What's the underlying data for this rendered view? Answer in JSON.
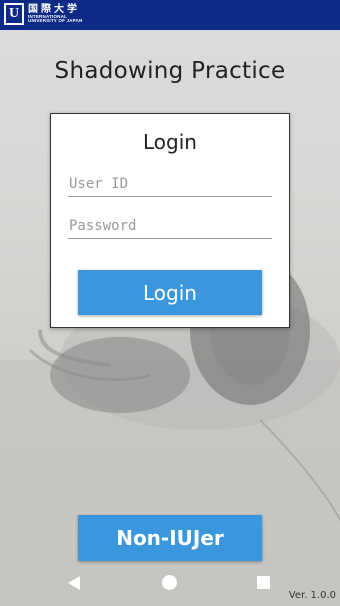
{
  "header": {
    "logo_mark": "U",
    "logo_jp": "国際大学",
    "logo_en_line1": "INTERNATIONAL",
    "logo_en_line2": "UNIVERSITY OF JAPAN"
  },
  "app": {
    "title": "Shadowing Practice"
  },
  "login": {
    "heading": "Login",
    "user_id_placeholder": "User ID",
    "password_placeholder": "Password",
    "submit_label": "Login"
  },
  "secondary_button": {
    "label": "Non-IUJer"
  },
  "nav": {
    "back_icon": "triangle-back-icon",
    "home_icon": "circle-home-icon",
    "recents_icon": "square-recents-icon"
  },
  "footer": {
    "version": "Ver. 1.0.0"
  },
  "colors": {
    "header_bg": "#0d2b86",
    "button_bg": "#3a97de",
    "button_text": "#ffffff"
  }
}
